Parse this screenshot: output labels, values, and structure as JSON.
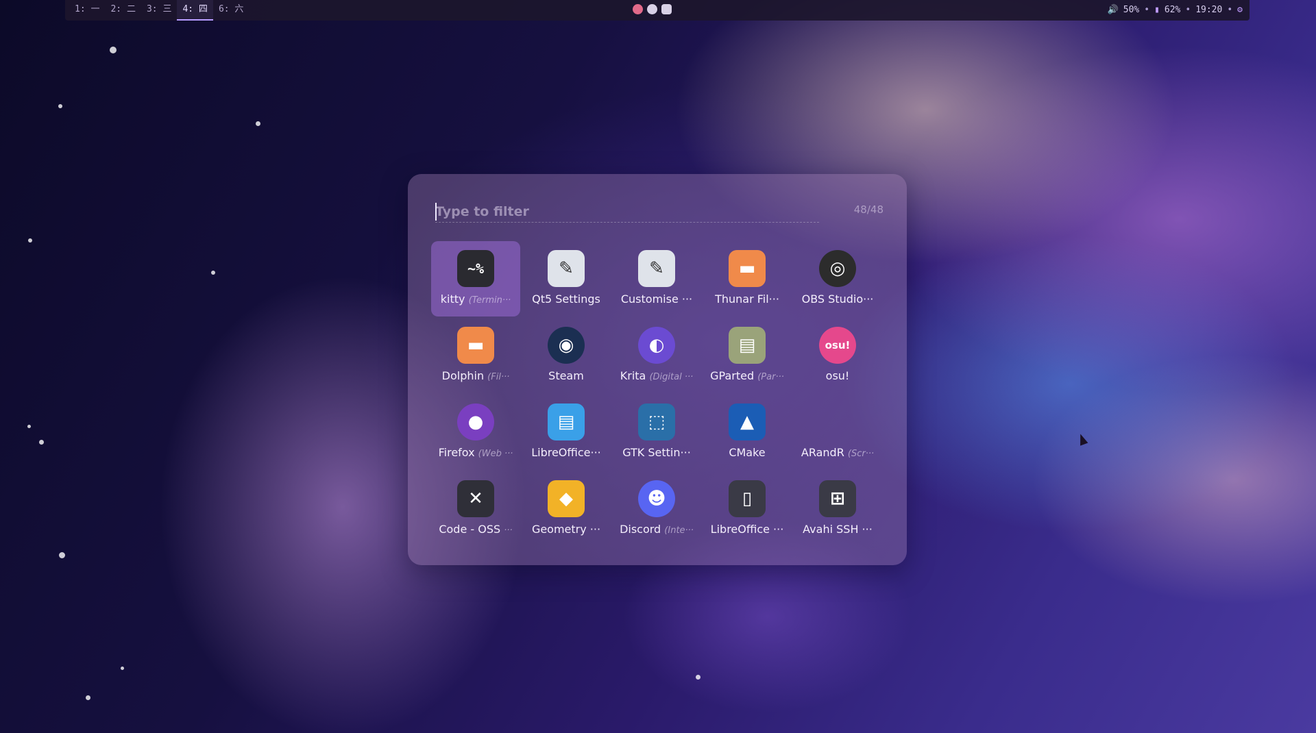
{
  "topbar": {
    "workspaces": [
      {
        "label": "1: 一",
        "active": false
      },
      {
        "label": "2: 二",
        "active": false
      },
      {
        "label": "3: 三",
        "active": false
      },
      {
        "label": "4: 四",
        "active": true
      },
      {
        "label": "6: 六",
        "active": false
      }
    ],
    "tray": [
      "osu-icon",
      "steam-icon",
      "discord-icon"
    ],
    "status": {
      "volume": "50%",
      "battery": "62%",
      "time": "19:20"
    }
  },
  "launcher": {
    "placeholder": "Type to filter",
    "count": "48/48",
    "apps": [
      {
        "name": "kitty",
        "comment": "(Termin···",
        "icon": "terminal-icon",
        "color": "#2a2a30",
        "selected": true
      },
      {
        "name": "Qt5 Settings",
        "comment": "",
        "icon": "paintbrush-icon",
        "color": "#dfe3ea"
      },
      {
        "name": "Customise ···",
        "comment": "",
        "icon": "paintbrush-icon",
        "color": "#dfe3ea"
      },
      {
        "name": "Thunar Fil···",
        "comment": "",
        "icon": "folder-icon",
        "color": "#f08a4a"
      },
      {
        "name": "OBS Studio···",
        "comment": "",
        "icon": "obs-icon",
        "color": "#2c2c2c"
      },
      {
        "name": "Dolphin",
        "comment": "(Fil···",
        "icon": "folder-icon",
        "color": "#f08a4a"
      },
      {
        "name": "Steam",
        "comment": "",
        "icon": "steam-icon",
        "color": "#1b2f52"
      },
      {
        "name": "Krita",
        "comment": "(Digital ···",
        "icon": "krita-icon",
        "color": "#6b4bd2"
      },
      {
        "name": "GParted",
        "comment": "(Par···",
        "icon": "gparted-icon",
        "color": "#9aa37a"
      },
      {
        "name": "osu!",
        "comment": "",
        "icon": "osu-icon",
        "color": "#e5488c"
      },
      {
        "name": "Firefox",
        "comment": "(Web ···",
        "icon": "firefox-icon",
        "color": "#7a3fc0"
      },
      {
        "name": "LibreOffice···",
        "comment": "",
        "icon": "document-icon",
        "color": "#3aa0e8"
      },
      {
        "name": "GTK Settin···",
        "comment": "",
        "icon": "gtk-settings-icon",
        "color": "#2a6fa8"
      },
      {
        "name": "CMake",
        "comment": "",
        "icon": "cmake-icon",
        "color": "#1b5db5"
      },
      {
        "name": "ARandR",
        "comment": "(Scr···",
        "icon": "display-icon",
        "color": "#00000000"
      },
      {
        "name": "Code - OSS",
        "comment": "···",
        "icon": "vscode-icon",
        "color": "#2f2f38"
      },
      {
        "name": "Geometry ···",
        "comment": "",
        "icon": "geometry-dash-icon",
        "color": "#f2b227"
      },
      {
        "name": "Discord",
        "comment": "(Inte···",
        "icon": "discord-icon",
        "color": "#5865f2"
      },
      {
        "name": "LibreOffice ···",
        "comment": "",
        "icon": "libreoffice-icon",
        "color": "#3a3a46"
      },
      {
        "name": "Avahi SSH ···",
        "comment": "",
        "icon": "network-icon",
        "color": "#3a3a46"
      }
    ]
  }
}
